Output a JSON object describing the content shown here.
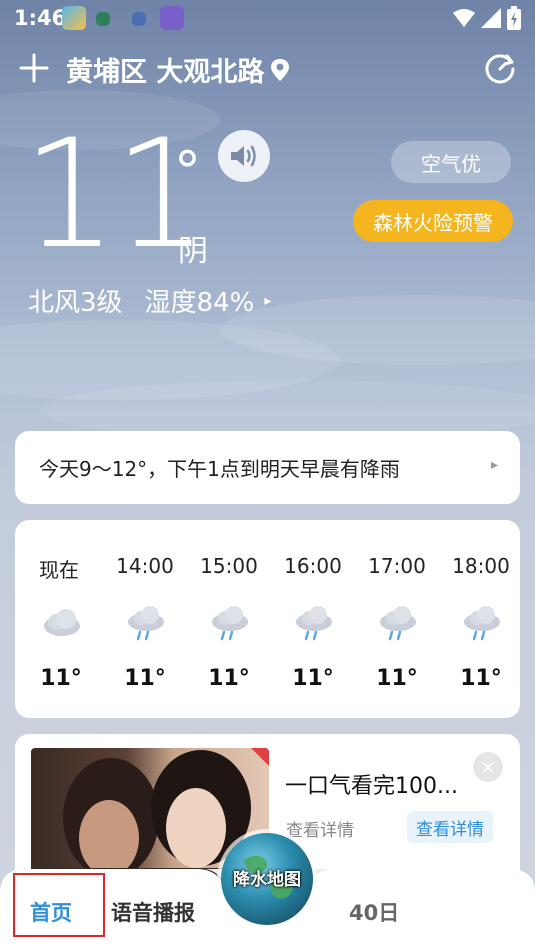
{
  "status_bar": {
    "time": "1:46"
  },
  "header": {
    "location": "黄埔区 大观北路"
  },
  "current": {
    "temperature": "11",
    "degree_symbol": "°",
    "condition": "阴",
    "wind": "北风3级",
    "humidity": "湿度84%",
    "air_quality": "空气优",
    "warning": "森林火险预警"
  },
  "summary": {
    "text": "今天9～12°，下午1点到明天早晨有降雨"
  },
  "hourly": [
    {
      "time": "现在",
      "temp": "11°",
      "icon": "cloud-icon"
    },
    {
      "time": "14:00",
      "temp": "11°",
      "icon": "rain-icon"
    },
    {
      "time": "15:00",
      "temp": "11°",
      "icon": "rain-icon"
    },
    {
      "time": "16:00",
      "temp": "11°",
      "icon": "rain-icon"
    },
    {
      "time": "17:00",
      "temp": "11°",
      "icon": "rain-icon"
    },
    {
      "time": "18:00",
      "temp": "11°",
      "icon": "rain-icon"
    }
  ],
  "ad": {
    "title": "一口气看完100...",
    "sub": "查看详情",
    "cta": "查看详情",
    "close": "×"
  },
  "nav": {
    "home": "首页",
    "voice": "语音播报",
    "map": "降水地图",
    "forty": "40日"
  },
  "colors": {
    "accent_blue": "#2f8fd8",
    "warning_yellow": "#f4b51e",
    "highlight_red": "#e0262b"
  }
}
